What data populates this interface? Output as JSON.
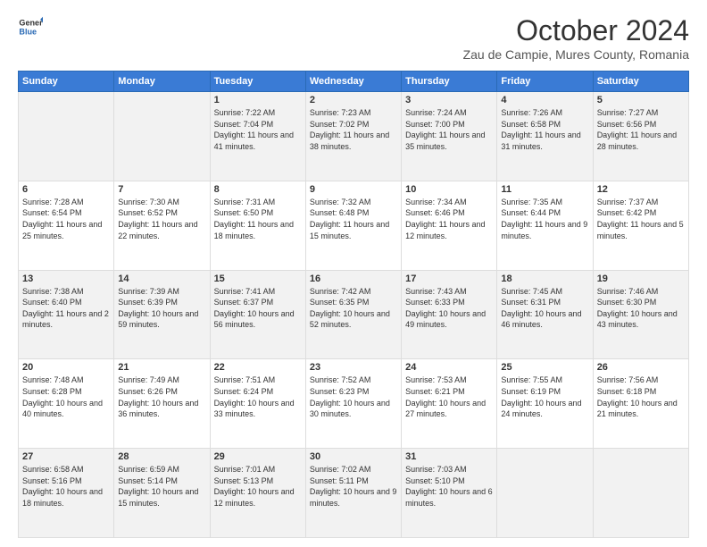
{
  "header": {
    "logo": {
      "general": "General",
      "blue": "Blue"
    },
    "title": "October 2024",
    "subtitle": "Zau de Campie, Mures County, Romania"
  },
  "weekdays": [
    "Sunday",
    "Monday",
    "Tuesday",
    "Wednesday",
    "Thursday",
    "Friday",
    "Saturday"
  ],
  "rows": [
    [
      {
        "day": "",
        "text": ""
      },
      {
        "day": "",
        "text": ""
      },
      {
        "day": "1",
        "text": "Sunrise: 7:22 AM\nSunset: 7:04 PM\nDaylight: 11 hours and 41 minutes."
      },
      {
        "day": "2",
        "text": "Sunrise: 7:23 AM\nSunset: 7:02 PM\nDaylight: 11 hours and 38 minutes."
      },
      {
        "day": "3",
        "text": "Sunrise: 7:24 AM\nSunset: 7:00 PM\nDaylight: 11 hours and 35 minutes."
      },
      {
        "day": "4",
        "text": "Sunrise: 7:26 AM\nSunset: 6:58 PM\nDaylight: 11 hours and 31 minutes."
      },
      {
        "day": "5",
        "text": "Sunrise: 7:27 AM\nSunset: 6:56 PM\nDaylight: 11 hours and 28 minutes."
      }
    ],
    [
      {
        "day": "6",
        "text": "Sunrise: 7:28 AM\nSunset: 6:54 PM\nDaylight: 11 hours and 25 minutes."
      },
      {
        "day": "7",
        "text": "Sunrise: 7:30 AM\nSunset: 6:52 PM\nDaylight: 11 hours and 22 minutes."
      },
      {
        "day": "8",
        "text": "Sunrise: 7:31 AM\nSunset: 6:50 PM\nDaylight: 11 hours and 18 minutes."
      },
      {
        "day": "9",
        "text": "Sunrise: 7:32 AM\nSunset: 6:48 PM\nDaylight: 11 hours and 15 minutes."
      },
      {
        "day": "10",
        "text": "Sunrise: 7:34 AM\nSunset: 6:46 PM\nDaylight: 11 hours and 12 minutes."
      },
      {
        "day": "11",
        "text": "Sunrise: 7:35 AM\nSunset: 6:44 PM\nDaylight: 11 hours and 9 minutes."
      },
      {
        "day": "12",
        "text": "Sunrise: 7:37 AM\nSunset: 6:42 PM\nDaylight: 11 hours and 5 minutes."
      }
    ],
    [
      {
        "day": "13",
        "text": "Sunrise: 7:38 AM\nSunset: 6:40 PM\nDaylight: 11 hours and 2 minutes."
      },
      {
        "day": "14",
        "text": "Sunrise: 7:39 AM\nSunset: 6:39 PM\nDaylight: 10 hours and 59 minutes."
      },
      {
        "day": "15",
        "text": "Sunrise: 7:41 AM\nSunset: 6:37 PM\nDaylight: 10 hours and 56 minutes."
      },
      {
        "day": "16",
        "text": "Sunrise: 7:42 AM\nSunset: 6:35 PM\nDaylight: 10 hours and 52 minutes."
      },
      {
        "day": "17",
        "text": "Sunrise: 7:43 AM\nSunset: 6:33 PM\nDaylight: 10 hours and 49 minutes."
      },
      {
        "day": "18",
        "text": "Sunrise: 7:45 AM\nSunset: 6:31 PM\nDaylight: 10 hours and 46 minutes."
      },
      {
        "day": "19",
        "text": "Sunrise: 7:46 AM\nSunset: 6:30 PM\nDaylight: 10 hours and 43 minutes."
      }
    ],
    [
      {
        "day": "20",
        "text": "Sunrise: 7:48 AM\nSunset: 6:28 PM\nDaylight: 10 hours and 40 minutes."
      },
      {
        "day": "21",
        "text": "Sunrise: 7:49 AM\nSunset: 6:26 PM\nDaylight: 10 hours and 36 minutes."
      },
      {
        "day": "22",
        "text": "Sunrise: 7:51 AM\nSunset: 6:24 PM\nDaylight: 10 hours and 33 minutes."
      },
      {
        "day": "23",
        "text": "Sunrise: 7:52 AM\nSunset: 6:23 PM\nDaylight: 10 hours and 30 minutes."
      },
      {
        "day": "24",
        "text": "Sunrise: 7:53 AM\nSunset: 6:21 PM\nDaylight: 10 hours and 27 minutes."
      },
      {
        "day": "25",
        "text": "Sunrise: 7:55 AM\nSunset: 6:19 PM\nDaylight: 10 hours and 24 minutes."
      },
      {
        "day": "26",
        "text": "Sunrise: 7:56 AM\nSunset: 6:18 PM\nDaylight: 10 hours and 21 minutes."
      }
    ],
    [
      {
        "day": "27",
        "text": "Sunrise: 6:58 AM\nSunset: 5:16 PM\nDaylight: 10 hours and 18 minutes."
      },
      {
        "day": "28",
        "text": "Sunrise: 6:59 AM\nSunset: 5:14 PM\nDaylight: 10 hours and 15 minutes."
      },
      {
        "day": "29",
        "text": "Sunrise: 7:01 AM\nSunset: 5:13 PM\nDaylight: 10 hours and 12 minutes."
      },
      {
        "day": "30",
        "text": "Sunrise: 7:02 AM\nSunset: 5:11 PM\nDaylight: 10 hours and 9 minutes."
      },
      {
        "day": "31",
        "text": "Sunrise: 7:03 AM\nSunset: 5:10 PM\nDaylight: 10 hours and 6 minutes."
      },
      {
        "day": "",
        "text": ""
      },
      {
        "day": "",
        "text": ""
      }
    ]
  ]
}
